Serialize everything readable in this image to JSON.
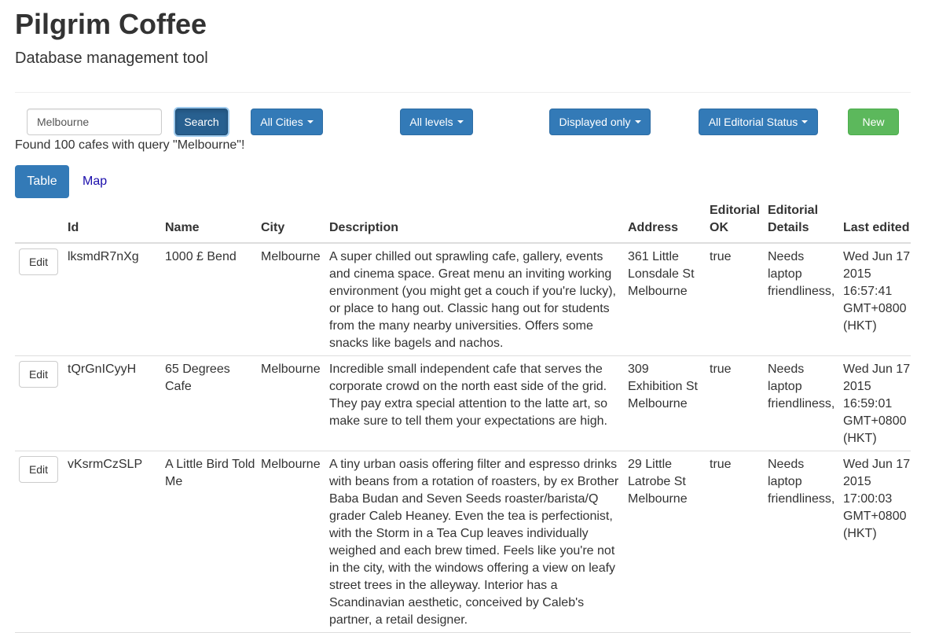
{
  "header": {
    "title": "Pilgrim Coffee",
    "subtitle": "Database management tool"
  },
  "toolbar": {
    "search_value": "Melbourne",
    "search_label": "Search",
    "cities_label": "All Cities",
    "levels_label": "All levels",
    "displayed_label": "Displayed only",
    "editorial_label": "All Editorial Status",
    "new_label": "New"
  },
  "status_text": "Found 100 cafes with query \"Melbourne\"!",
  "tabs": {
    "table": "Table",
    "map": "Map"
  },
  "table": {
    "columns": {
      "id": "Id",
      "name": "Name",
      "city": "City",
      "description": "Description",
      "address": "Address",
      "editorial_ok": "Editorial OK",
      "editorial_details": "Editorial Details",
      "last_edited": "Last edited"
    },
    "edit_label": "Edit",
    "rows": [
      {
        "id": "lksmdR7nXg",
        "name": "1000 £ Bend",
        "city": "Melbourne",
        "description": "A super chilled out sprawling cafe, gallery, events and cinema space. Great menu an inviting working environment (you might get a couch if you're lucky), or place to hang out. Classic hang out for students from the many nearby universities. Offers some snacks like bagels and nachos.",
        "address": "361 Little Lonsdale St Melbourne",
        "editorial_ok": "true",
        "editorial_details": "Needs laptop friendliness,",
        "last_edited": "Wed Jun 17 2015 16:57:41 GMT+0800 (HKT)"
      },
      {
        "id": "tQrGnICyyH",
        "name": "65 Degrees Cafe",
        "city": "Melbourne",
        "description": "Incredible small independent cafe that serves the corporate crowd on the north east side of the grid. They pay extra special attention to the latte art, so make sure to tell them your expectations are high.",
        "address": "309 Exhibition St Melbourne",
        "editorial_ok": "true",
        "editorial_details": "Needs laptop friendliness,",
        "last_edited": "Wed Jun 17 2015 16:59:01 GMT+0800 (HKT)"
      },
      {
        "id": "vKsrmCzSLP",
        "name": "A Little Bird Told Me",
        "city": "Melbourne",
        "description": "A tiny urban oasis offering filter and espresso drinks with beans from a rotation of roasters, by ex Brother Baba Budan and Seven Seeds roaster/barista/Q grader Caleb Heaney. Even the tea is perfectionist, with the Storm in a Tea Cup leaves individually weighed and each brew timed. Feels like you're not in the city, with the windows offering a view on leafy street trees in the alleyway. Interior has a Scandinavian aesthetic, conceived by Caleb's partner, a retail designer.",
        "address": "29 Little Latrobe St Melbourne",
        "editorial_ok": "true",
        "editorial_details": "Needs laptop friendliness,",
        "last_edited": "Wed Jun 17 2015 17:00:03 GMT+0800 (HKT)"
      }
    ]
  }
}
